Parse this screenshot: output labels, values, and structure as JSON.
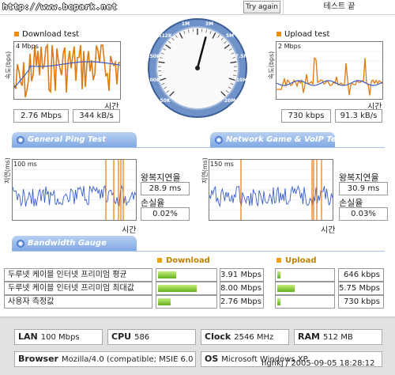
{
  "header": {
    "url": "http://www.bcpark.net",
    "try_again": "Try again",
    "test_end": "테스트 끝"
  },
  "download": {
    "title": "Download test",
    "ylabel": "속도(bps)",
    "max_label": "4 Mbps",
    "xlabel": "시간",
    "mbps": "2.76 Mbps",
    "kbs": "344 kB/s"
  },
  "upload": {
    "title": "Upload test",
    "ylabel": "속도(bps)",
    "max_label": "2 Mbps",
    "xlabel": "시간",
    "mbps": "730 kbps",
    "kbs": "91.3 kB/s"
  },
  "gauge": {
    "ticks": [
      "50K",
      "100K",
      "250K",
      "512K",
      "1M",
      "3M",
      "5M",
      "7.5M",
      "10M",
      "20M"
    ],
    "needle_value": "3M"
  },
  "tabs": {
    "ping": "General Ping Test",
    "game": "Network Game & VoIP Test",
    "bandwidth": "Bandwidth Gauge"
  },
  "ping": {
    "ylabel": "지연(ms)",
    "max_label": "100 ms",
    "xlabel": "시간",
    "rtt_label": "왕복지연율",
    "rtt_value": "28.9 ms",
    "loss_label": "손실율",
    "loss_value": "0.02%"
  },
  "game": {
    "ylabel": "지연(ms)",
    "max_label": "150 ms",
    "xlabel": "시간",
    "rtt_label": "왕복지연율",
    "rtt_value": "30.9 ms",
    "loss_label": "손실율",
    "loss_value": "0.03%"
  },
  "bandwidth": {
    "download_label": "Download",
    "upload_label": "Upload",
    "rows": [
      {
        "label": "두루넷 케이블 인터넷 프리미엄 평균",
        "down": "3.91 Mbps",
        "down_frac": 0.31,
        "up": "646 kbps",
        "up_frac": 0.04
      },
      {
        "label": "두루넷 케이블 인터넷 프리미엄 최대값",
        "down": "8.00 Mbps",
        "down_frac": 0.66,
        "up": "5.75 Mbps",
        "up_frac": 0.3
      },
      {
        "label": "사용자 측정값",
        "down": "2.76 Mbps",
        "down_frac": 0.22,
        "up": "730 kbps",
        "up_frac": 0.05
      }
    ]
  },
  "system": {
    "lan_label": "LAN",
    "lan_value": "100 Mbps",
    "cpu_label": "CPU",
    "cpu_value": "586",
    "clock_label": "Clock",
    "clock_value": "2546 MHz",
    "ram_label": "RAM",
    "ram_value": "512 MB",
    "browser_label": "Browser",
    "browser_value": "Mozilla/4.0 (compatible; MSIE 6.0",
    "os_label": "OS",
    "os_value": "Microsoft Windows XP"
  },
  "stamp": "nghkj / 2005-09-05 18:28:12",
  "colors": {
    "download_line": "#e07a10",
    "avg_line": "#3a5fcd",
    "tab_blue": "#7ea7e2",
    "bar_green": "#62b01c",
    "accent_orange": "#f08a00"
  }
}
